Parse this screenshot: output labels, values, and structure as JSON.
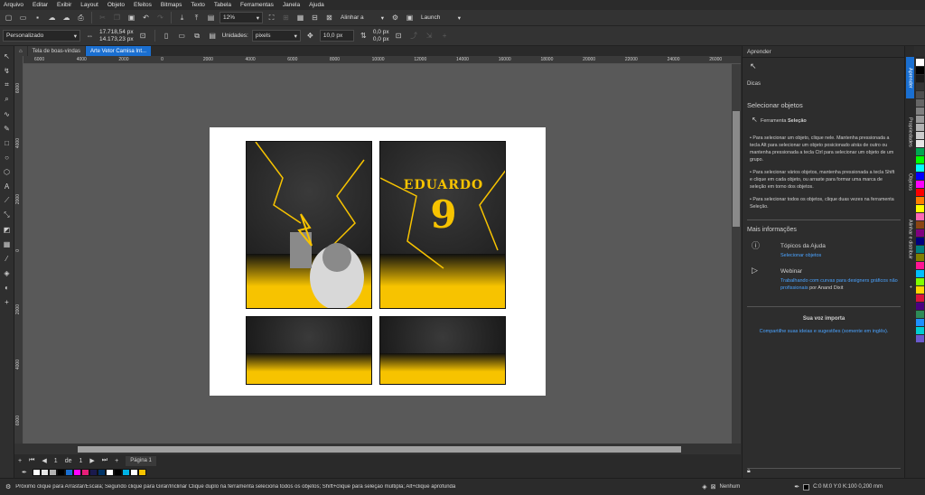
{
  "menu": [
    "Arquivo",
    "Editar",
    "Exibir",
    "Layout",
    "Objeto",
    "Efeitos",
    "Bitmaps",
    "Texto",
    "Tabela",
    "Ferramentas",
    "Janela",
    "Ajuda"
  ],
  "standard_toolbar": {
    "zoom": "12%",
    "align_label": "Alinhar a",
    "launch_label": "Launch"
  },
  "property_bar": {
    "preset": "Personalizado",
    "width": "17.718,54 px",
    "height": "14.173,23 px",
    "units_label": "Unidades:",
    "units_value": "pixels",
    "nudge": "10,0 px",
    "dup_x": "0,0 px",
    "dup_y": "0,0 px"
  },
  "doc_tabs": [
    "Tela de boas-vindas",
    "Arte Vetor Camisa Int..."
  ],
  "ruler_h": [
    "6000",
    "4000",
    "2000",
    "0",
    "2000",
    "4000",
    "6000",
    "8000",
    "10000",
    "12000",
    "14000",
    "16000",
    "18000",
    "20000",
    "22000",
    "24000",
    "26000"
  ],
  "ruler_v": [
    "6000",
    "4000",
    "2000",
    "0",
    "2000",
    "4000",
    "6000"
  ],
  "artwork": {
    "name_text": "EDUARDO",
    "number_text": "9"
  },
  "page_nav": {
    "current": "1",
    "of": "de",
    "total": "1",
    "page_tab": "Página 1"
  },
  "status": {
    "hint": "Próximo clique para Arrastar/Escala; Segundo clique para Girar/Inclinar Clique duplo na ferramenta seleciona todos os objetos; Shift+clique para seleção múltipla; Alt+clique aprofunda",
    "fill": "Nenhum",
    "outline": "C:0 M:0 Y:0 K:100  0,200 mm"
  },
  "panel": {
    "title": "Aprender",
    "section": "Dicas",
    "heading": "Selecionar objetos",
    "tool_prefix": "Ferramenta",
    "tool_name": "Seleção",
    "bullet1": "Para selecionar um objeto, clique nele. Mantenha pressionada a tecla Alt para selecionar um objeto posicionado atrás de outro ou mantenha pressionada a tecla Ctrl para selecionar um objeto de um grupo.",
    "bullet2": "Para selecionar vários objetos, mantenha pressionada a tecla Shift e clique em cada objeto, ou arraste para formar uma marca de seleção em torno dos objetos.",
    "bullet3": "Para selecionar todos os objetos, clique duas vezes na ferramenta Seleção.",
    "more_info": "Mais informações",
    "help_title": "Tópicos da Ajuda",
    "help_link": "Selecionar objetos",
    "webinar_title": "Webinar",
    "webinar_link": "Trabalhando com curvas para designers gráficos não profissionais",
    "webinar_by": "por Anand Dixit",
    "voice_title": "Sua voz importa",
    "voice_link": "Compartilhe suas ideias e sugestões (somente em inglês)."
  },
  "side_tabs": [
    "Aprender",
    "Propriedades",
    "Objetos",
    "Alinhar e distribuir"
  ],
  "colors": {
    "accent": "#1a6fd1",
    "canvas_bg": "#595959",
    "art_yellow": "#f7c300",
    "panel_bg": "#2d2d2d"
  },
  "palette_right": [
    "#ffffff",
    "#000000",
    "#1a1a1a",
    "#333333",
    "#4d4d4d",
    "#666666",
    "#808080",
    "#999999",
    "#b3b3b3",
    "#cccccc",
    "#e6e6e6",
    "#00a651",
    "#00ff00",
    "#00ffff",
    "#0000ff",
    "#ff00ff",
    "#ff0000",
    "#ff7f00",
    "#ffff00",
    "#ff69b4",
    "#8b4513",
    "#800080",
    "#000080",
    "#008080",
    "#808000",
    "#ff1493",
    "#00bfff",
    "#7fff00",
    "#ffd700",
    "#dc143c",
    "#4b0082",
    "#2e8b57",
    "#1e90ff",
    "#00ced1",
    "#6a5acd"
  ],
  "palette_bottom": [
    "#ffffff",
    "#e6e6e6",
    "#b3b3b3",
    "#000000",
    "#1a6fd1",
    "#ff00ff",
    "#e61e78",
    "#1a1a4d",
    "#003366",
    "#ffffff",
    "#000000",
    "#00b3e6",
    "#ffffff",
    "#f7c300"
  ]
}
